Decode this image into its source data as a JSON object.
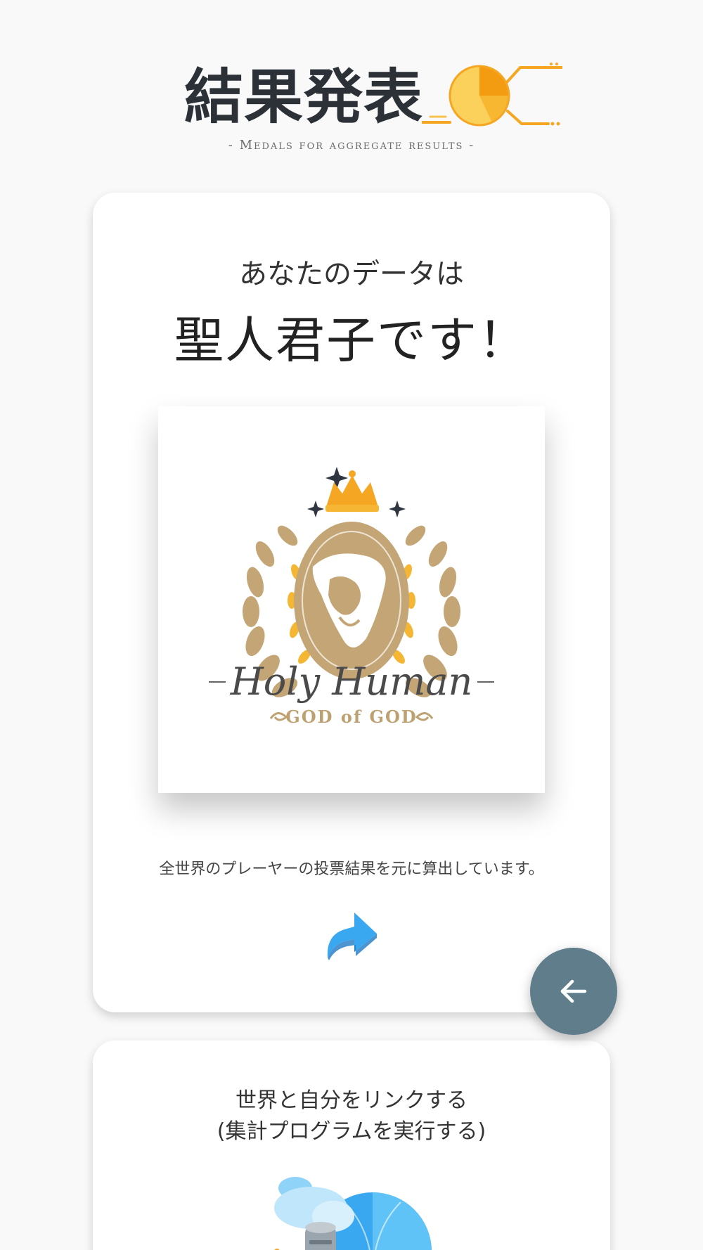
{
  "header": {
    "title": "結果発表",
    "subtitle": "- Medals for aggregate results -"
  },
  "result": {
    "lead": "あなたのデータは",
    "title": "聖人君子です！",
    "medal": {
      "name": "Holy Human",
      "tagline": "GOD of GOD"
    },
    "caption": "全世界のプレーヤーの投票結果を元に算出しています。"
  },
  "link_card": {
    "line1": "世界と自分をリンクする",
    "line2": "(集計プログラムを実行する)"
  },
  "icons": {
    "chart": "pie-chart-icon",
    "share": "share-arrow-icon",
    "back": "arrow-left-icon",
    "link": "globe-server-icon"
  },
  "colors": {
    "background": "#f9f9f9",
    "card": "#ffffff",
    "fab": "#607d8b",
    "gold": "#f5a623",
    "medal_brown": "#c4a676",
    "share_blue": "#3aa8f0"
  }
}
